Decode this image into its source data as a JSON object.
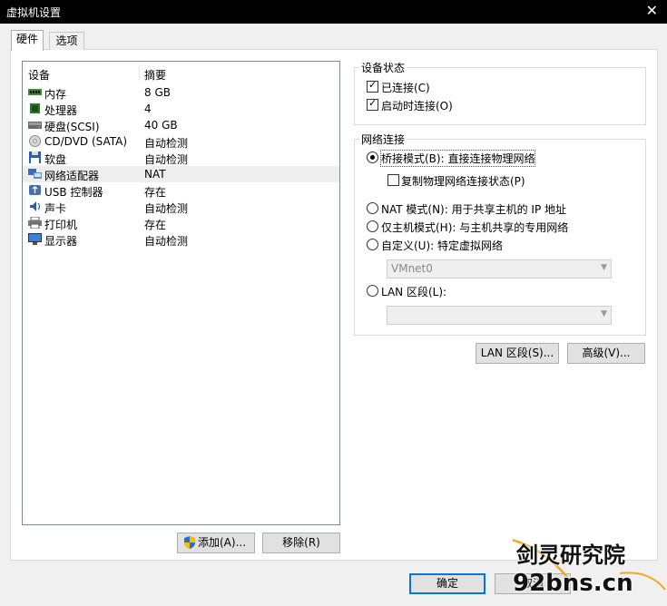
{
  "window": {
    "title": "虚拟机设置",
    "close_glyph": "✕"
  },
  "tabs": [
    {
      "label": "硬件"
    },
    {
      "label": "选项"
    }
  ],
  "device_list": {
    "col_device": "设备",
    "col_summary": "摘要",
    "rows": [
      {
        "name": "内存",
        "summary": "8 GB",
        "icon": "memory-icon"
      },
      {
        "name": "处理器",
        "summary": "4",
        "icon": "cpu-icon"
      },
      {
        "name": "硬盘(SCSI)",
        "summary": "40 GB",
        "icon": "harddisk-icon"
      },
      {
        "name": "CD/DVD (SATA)",
        "summary": "自动检测",
        "icon": "cd-dvd-icon"
      },
      {
        "name": "软盘",
        "summary": "自动检测",
        "icon": "floppy-icon"
      },
      {
        "name": "网络适配器",
        "summary": "NAT",
        "icon": "network-adapter-icon",
        "selected": true
      },
      {
        "name": "USB 控制器",
        "summary": "存在",
        "icon": "usb-icon"
      },
      {
        "name": "声卡",
        "summary": "自动检测",
        "icon": "sound-card-icon"
      },
      {
        "name": "打印机",
        "summary": "存在",
        "icon": "printer-icon"
      },
      {
        "name": "显示器",
        "summary": "自动检测",
        "icon": "display-icon"
      }
    ]
  },
  "buttons": {
    "add": "添加(A)...",
    "remove": "移除(R)",
    "lan_segments": "LAN 区段(S)...",
    "advanced": "高级(V)...",
    "ok": "确定",
    "cancel": "取消"
  },
  "device_status": {
    "title": "设备状态",
    "connected": {
      "label": "已连接(C)",
      "checked": true
    },
    "connect_at_power_on": {
      "label": "启动时连接(O)",
      "checked": true
    }
  },
  "network_connection": {
    "title": "网络连接",
    "bridged": {
      "label": "桥接模式(B): 直接连接物理网络",
      "selected": true
    },
    "replicate": {
      "label": "复制物理网络连接状态(P)",
      "checked": false
    },
    "nat": {
      "label": "NAT 模式(N): 用于共享主机的 IP 地址",
      "selected": false
    },
    "host_only": {
      "label": "仅主机模式(H): 与主机共享的专用网络",
      "selected": false
    },
    "custom": {
      "label": "自定义(U): 特定虚拟网络",
      "selected": false
    },
    "custom_combo_value": "VMnet0",
    "lan_segment": {
      "label": "LAN 区段(L):",
      "selected": false
    },
    "lan_combo_value": ""
  },
  "watermark": {
    "text_cn": "剑灵研究院",
    "text_en": "92bns.cn",
    "accent": "#f5a623"
  }
}
